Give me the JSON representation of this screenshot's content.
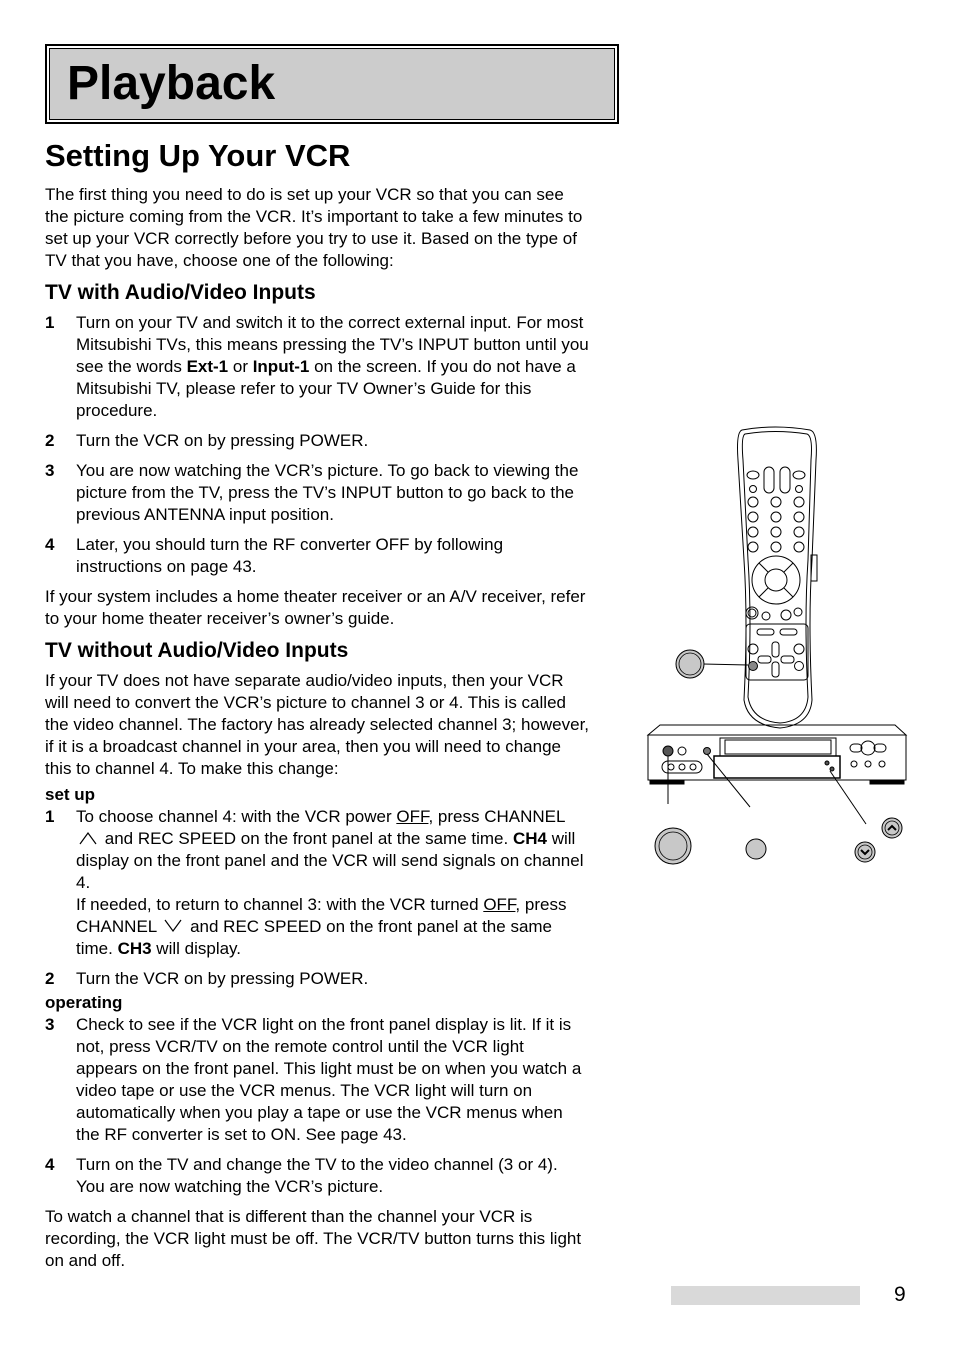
{
  "header": {
    "title": "Playback"
  },
  "section_title": "Setting Up Your VCR",
  "intro": "The first thing you need to do is set up your VCR so that you can see the picture coming from the VCR.  It’s important to take a few minutes to set up your VCR correctly before you try to use it.  Based on the type of TV that you have, choose one of the following:",
  "av_section": {
    "heading": "TV with Audio/Video Inputs",
    "steps": [
      {
        "num": "1",
        "text_a": "Turn on your TV and switch it to the correct external input.  For most Mitsubishi TVs, this means pressing the TV’s INPUT button until you see the words ",
        "bold1": "Ext-1",
        "text_b": " or ",
        "bold2": "Input-1",
        "text_c": " on the screen.  If you do not have a Mitsubishi TV, please refer to your TV Owner’s Guide for this procedure."
      },
      {
        "num": "2",
        "text": "Turn the VCR on by pressing POWER."
      },
      {
        "num": "3",
        "text": "You are now watching the VCR’s picture.  To go back to viewing the picture from the TV, press the TV’s INPUT button to go back to the previous ANTENNA input position."
      },
      {
        "num": "4",
        "text": "Later, you should turn the RF converter OFF by following instructions on page 43."
      }
    ],
    "note": "If your system includes a home theater receiver or an A/V receiver, refer to your home theater receiver’s owner’s guide."
  },
  "noav_section": {
    "heading": "TV without Audio/Video Inputs",
    "intro": "If your TV does not have separate audio/video inputs, then your VCR will need to convert the VCR’s picture to channel 3 or 4.  This is called the video channel.  The factory has already selected channel 3; however, if it is a broadcast channel in your area, then you will need to change this to channel 4.  To make this change:",
    "setup_label": "set up",
    "step1": {
      "num": "1",
      "a": "To choose channel 4: with the VCR power ",
      "off1": "OFF",
      "b": ", press CHANNEL",
      "c": "and REC SPEED on the front panel at the same time.  ",
      "ch4": "CH4",
      "d": " will display on the front panel and the VCR will send signals on channel 4.",
      "e": "If needed, to return to channel 3: with the VCR turned ",
      "off2": "OFF",
      "f": ", press CHANNEL",
      "g": "and REC SPEED on the front panel at the same time.  ",
      "ch3": "CH3",
      "h": " will display."
    },
    "step2": {
      "num": "2",
      "text": "Turn the VCR on by pressing POWER."
    },
    "operating_label": "operating",
    "step3": {
      "num": "3",
      "text": "Check to see if the VCR light on the front panel display is lit.  If it is not, press VCR/TV on the remote control until the VCR light appears on the front panel.  This light must be on when you watch a video tape or use the VCR menus.  The VCR light will turn on automatically when you play a tape or use the VCR menus when the RF converter is set to ON.  See page 43."
    },
    "step4": {
      "num": "4",
      "text": "Turn on the TV and change the TV to the video channel (3 or 4).  You are now watching the VCR’s picture."
    },
    "closing": "To watch a channel that is different than the channel your VCR is recording, the VCR light must be off.  The VCR/TV button turns this light on and off."
  },
  "footer": {
    "page_number": "9"
  },
  "colors": {
    "title_bg": "#cccccc",
    "page_bar": "#d9d9d9",
    "button_fill": "#c8c8c8"
  }
}
